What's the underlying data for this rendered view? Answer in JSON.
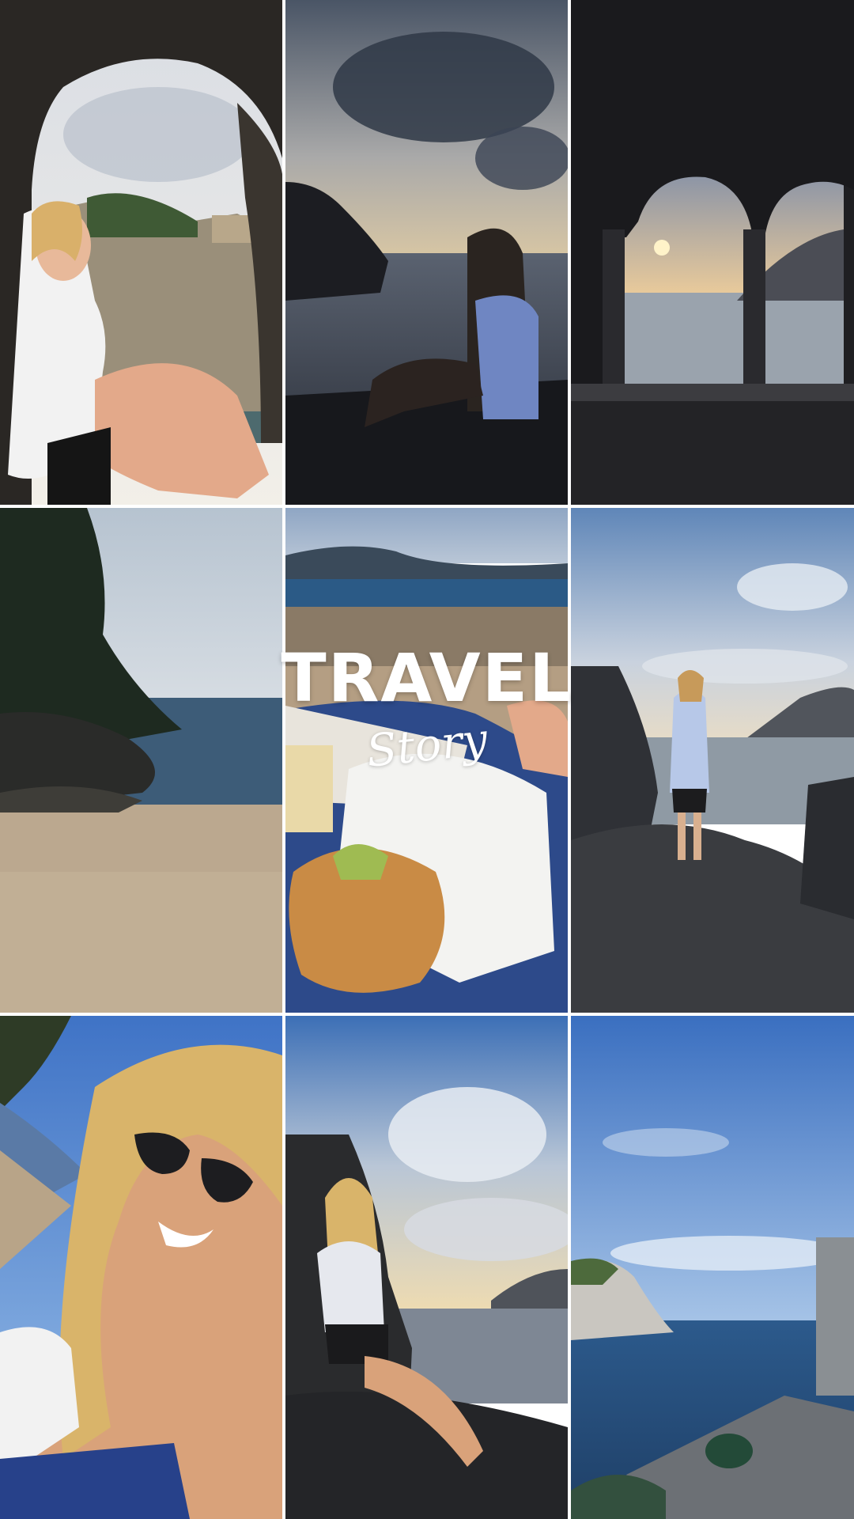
{
  "title": {
    "main": "TRAVEL",
    "script": "Story"
  },
  "tiles": [
    {
      "scene": "rock-arch-woman-seaside"
    },
    {
      "scene": "woman-sitting-rocks-cloudy-sea"
    },
    {
      "scene": "stone-arches-sunset-sea"
    },
    {
      "scene": "sandy-cove-rocks-sea"
    },
    {
      "scene": "beach-croissant-towel"
    },
    {
      "scene": "woman-standing-rocks-sea"
    },
    {
      "scene": "selfie-sunglasses-beach"
    },
    {
      "scene": "woman-leaning-rock-sunset"
    },
    {
      "scene": "harbor-blue-sky-sea"
    }
  ],
  "colors": {
    "gap": "#ffffff",
    "title": "#ffffff"
  }
}
